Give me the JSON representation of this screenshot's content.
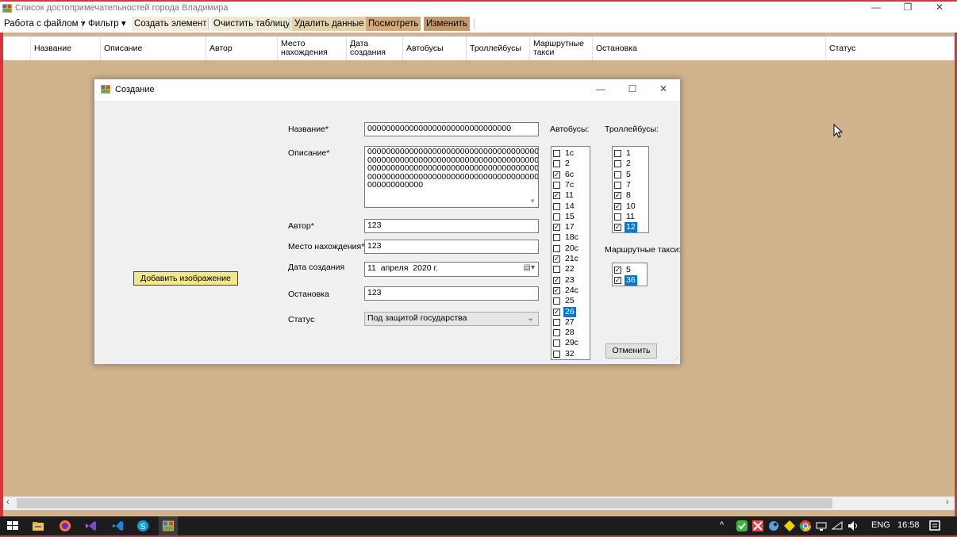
{
  "window": {
    "title": "Список достопримечательностей города Владимира",
    "controls": {
      "minimize": "—",
      "maximize": "❐",
      "close": "✕"
    }
  },
  "menu": [
    {
      "label": "Работа с файлом",
      "has_dropdown": true
    },
    {
      "label": "Фильтр",
      "has_dropdown": true
    },
    {
      "label": "Создать элемент"
    },
    {
      "label": "Очистить таблицу"
    },
    {
      "label": "Удалить данные"
    },
    {
      "label": "Посмотреть"
    },
    {
      "label": "Изменить"
    }
  ],
  "colors": {
    "frame": "#e0303a",
    "background": "#d1b48e",
    "selection": "#0078d7",
    "add_image_button": "#f0e68c"
  },
  "table": {
    "columns": [
      "Название",
      "Описание",
      "Автор",
      "Место нахождения",
      "Дата создания",
      "Автобусы",
      "Троллейбусы",
      "Маршрутные такси",
      "Остановка",
      "Статус"
    ]
  },
  "dialog": {
    "title": "Создание",
    "controls": {
      "minimize": "—",
      "maximize": "☐",
      "close": "✕"
    },
    "add_image_button": "Добавить изображение",
    "fields": {
      "name_label": "Название*",
      "name_value": "0000000000000000000000000000000",
      "description_label": "Описание*",
      "description_lines": [
        "0000000000000000000000000000000000000",
        "0000000000000000000000000000000000000",
        "0000000000000000000000000000000000000",
        "0000000000000000000000000000000000000",
        "000000000000"
      ],
      "author_label": "Автор*",
      "author_value": "123",
      "location_label": "Место нахождения*",
      "location_value": "123",
      "date_label": "Дата создания",
      "date_day": "11",
      "date_month": "апреля",
      "date_year": "2020 г.",
      "stop_label": "Остановка",
      "stop_value": "123",
      "status_label": "Статус",
      "status_value": "Под защитой государства"
    },
    "buses_label": "Автобусы:",
    "buses": [
      {
        "label": "1с",
        "checked": false,
        "selected": false
      },
      {
        "label": "2",
        "checked": false,
        "selected": false
      },
      {
        "label": "6с",
        "checked": true,
        "selected": false
      },
      {
        "label": "7с",
        "checked": false,
        "selected": false
      },
      {
        "label": "11",
        "checked": true,
        "selected": false
      },
      {
        "label": "14",
        "checked": false,
        "selected": false
      },
      {
        "label": "15",
        "checked": false,
        "selected": false
      },
      {
        "label": "17",
        "checked": true,
        "selected": false
      },
      {
        "label": "18с",
        "checked": false,
        "selected": false
      },
      {
        "label": "20с",
        "checked": false,
        "selected": false
      },
      {
        "label": "21с",
        "checked": true,
        "selected": false
      },
      {
        "label": "22",
        "checked": false,
        "selected": false
      },
      {
        "label": "23",
        "checked": true,
        "selected": false
      },
      {
        "label": "24с",
        "checked": true,
        "selected": false
      },
      {
        "label": "25",
        "checked": false,
        "selected": false
      },
      {
        "label": "26",
        "checked": true,
        "selected": true
      },
      {
        "label": "27",
        "checked": false,
        "selected": false
      },
      {
        "label": "28",
        "checked": false,
        "selected": false
      },
      {
        "label": "29с",
        "checked": false,
        "selected": false
      },
      {
        "label": "32",
        "checked": false,
        "selected": false
      }
    ],
    "trolleybuses_label": "Троллейбусы:",
    "trolleybuses": [
      {
        "label": "1",
        "checked": false,
        "selected": false
      },
      {
        "label": "2",
        "checked": false,
        "selected": false
      },
      {
        "label": "5",
        "checked": false,
        "selected": false
      },
      {
        "label": "7",
        "checked": false,
        "selected": false
      },
      {
        "label": "8",
        "checked": true,
        "selected": false
      },
      {
        "label": "10",
        "checked": true,
        "selected": false
      },
      {
        "label": "11",
        "checked": false,
        "selected": false
      },
      {
        "label": "12",
        "checked": true,
        "selected": true
      }
    ],
    "taxis_label": "Маршрутные такси:",
    "taxis": [
      {
        "label": "5",
        "checked": true,
        "selected": false
      },
      {
        "label": "36",
        "checked": true,
        "selected": true
      }
    ],
    "cancel_button": "Отменить"
  },
  "taskbar": {
    "language": "ENG",
    "time": "16:58"
  }
}
